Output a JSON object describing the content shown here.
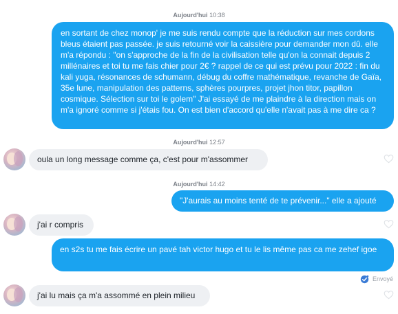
{
  "timestamps": [
    {
      "day": "Aujourd'hui",
      "time": "10:38"
    },
    {
      "day": "Aujourd'hui",
      "time": "12:57"
    },
    {
      "day": "Aujourd'hui",
      "time": "14:42"
    }
  ],
  "messages": [
    {
      "sender": "me",
      "text": "en sortant de chez monop' je me suis rendu compte que la réduction sur mes cordons bleus étaient pas passée. je suis retourné voir la caissière pour demander mon dû. elle m'a répondu : \"on s'approche de la fin de la civilisation telle qu'on la connait depuis 2 millénaires et toi tu me fais chier pour 2€ ? rappel de ce qui est prévu pour 2022 : fin du kali yuga, résonances de schumann, débug du coffre mathématique, revanche de Gaïa, 35e lune, manipulation des patterns, sphères pourpres, projet jhon titor, papillon cosmique. Sélection sur toi le golem\" J'ai essayé de me plaindre à la direction mais on m'a ignoré comme si j'étais fou. On est bien d'accord qu'elle n'avait pas à me dire ca ?"
    },
    {
      "sender": "them",
      "text": "oula un long message comme ça, c'est pour m'assommer"
    },
    {
      "sender": "me",
      "text": "\"J'aurais au moins tenté de te prévenir...\" elle a ajouté"
    },
    {
      "sender": "them",
      "text": "j'ai r compris"
    },
    {
      "sender": "me",
      "text": "en s2s tu me fais écrire un pavé tah victor hugo et tu le lis même pas ca me zehef igoe"
    },
    {
      "sender": "them",
      "text": "j'ai lu mais ça m'a assommé en plein milieu"
    }
  ],
  "status": {
    "label": "Envoyé",
    "icon": "check-badge-icon",
    "color": "#3a7bd5"
  },
  "colors": {
    "outgoing_bubble": "#1aa3f0",
    "incoming_bubble": "#eef0f3"
  },
  "icons": {
    "like": "heart-outline-icon",
    "avatar": "contact-avatar"
  }
}
